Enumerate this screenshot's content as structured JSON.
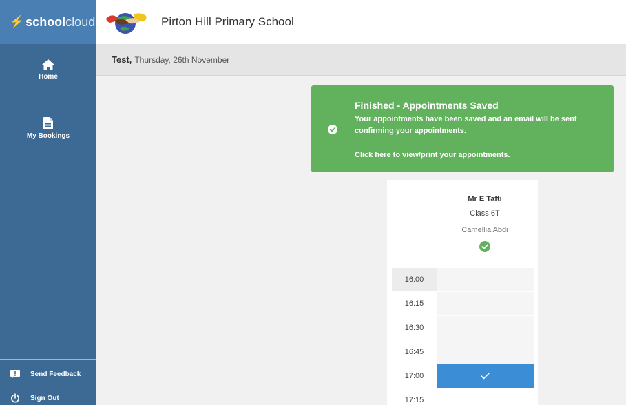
{
  "brand": {
    "part1": "school",
    "part2": "cloud"
  },
  "school": {
    "name": "Pirton Hill Primary School"
  },
  "event": {
    "name": "Test,",
    "date": "Thursday, 26th November"
  },
  "nav": {
    "home_label": "Home",
    "bookings_label": "My Bookings",
    "feedback_label": "Send Feedback",
    "signout_label": "Sign Out"
  },
  "alert": {
    "title": "Finished - Appointments Saved",
    "message": "Your appointments have been saved and an email will be sent confirming your appointments.",
    "link_text": "Click here",
    "link_suffix": " to view/print your appointments."
  },
  "teacher": {
    "name": "Mr E Tafti",
    "class": "Class 6T",
    "child": "Camellia Abdi"
  },
  "slots": [
    {
      "time": "16:00"
    },
    {
      "time": "16:15"
    },
    {
      "time": "16:30"
    },
    {
      "time": "16:45"
    },
    {
      "time": "17:00"
    },
    {
      "time": "17:15"
    }
  ],
  "booked_slot": "17:00",
  "colors": {
    "sidebar": "#3c6a94",
    "brand_bar": "#4a7fb3",
    "success": "#62b25d",
    "booked": "#3b8ed6"
  },
  "icons": [
    "home-icon",
    "document-icon",
    "feedback-icon",
    "power-icon",
    "check-circle-icon",
    "checkmark-icon",
    "school-logo"
  ]
}
